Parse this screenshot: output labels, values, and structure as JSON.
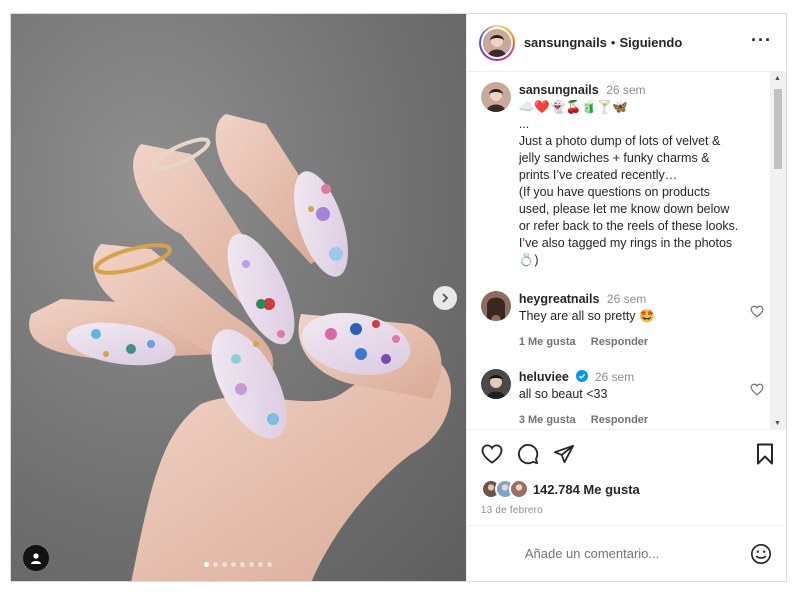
{
  "post": {
    "carousel": {
      "slides": 8,
      "active_index": 0
    },
    "author": {
      "username": "sansungnails",
      "separator": "•",
      "follow_status": "Siguiendo"
    },
    "caption": {
      "username": "sansungnails",
      "time": "26 sem",
      "lines": [
        "☁️❤️👻🍒🧃🍸🦋",
        "...",
        "Just a photo dump of lots of velvet &",
        "jelly sandwiches + funky charms &",
        "prints I’ve created recently…",
        "(If you have questions on products",
        "used, please let me know down below",
        "or refer back to the reels of these looks.",
        "I’ve also tagged my rings in the photos",
        "💍)"
      ]
    },
    "comments": [
      {
        "username": "heygreatnails",
        "time": "26 sem",
        "text": "They are all so pretty 🤩",
        "likes": "1 Me gusta",
        "reply": "Responder",
        "verified": false
      },
      {
        "username": "heluviee",
        "time": "26 sem",
        "text": "all so beaut <33",
        "likes": "3 Me gusta",
        "reply": "Responder",
        "verified": true
      }
    ],
    "likes_text": "142.784 Me gusta",
    "date": "13 de febrero",
    "comment_input": {
      "placeholder": "Añade un comentario..."
    },
    "icons": {
      "like": "heart-icon",
      "comment": "comment-icon",
      "share": "paper-plane-icon",
      "save": "bookmark-icon",
      "more": "more-options-icon",
      "emoji": "emoji-icon",
      "next": "chevron-right-icon",
      "tagged_users": "user-icon"
    }
  }
}
